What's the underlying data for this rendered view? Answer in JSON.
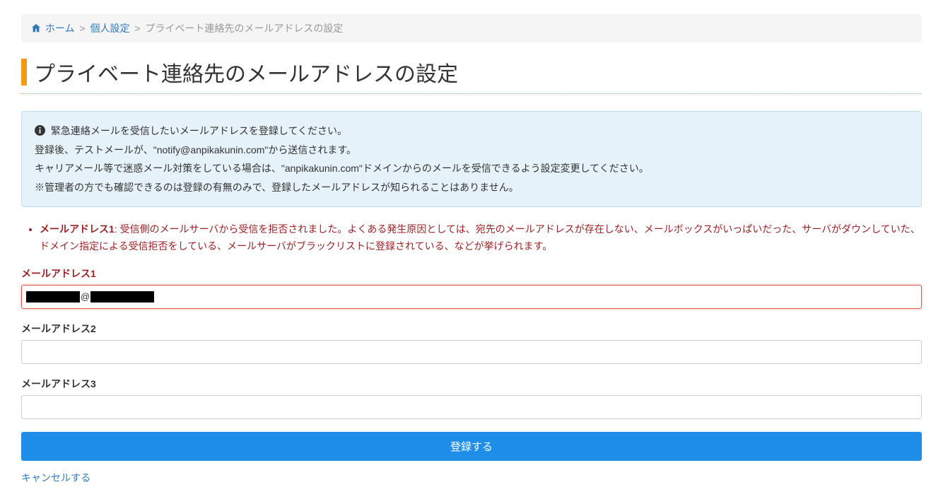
{
  "breadcrumb": {
    "home": "ホーム",
    "personal_settings": "個人設定",
    "current": "プライベート連絡先のメールアドレスの設定"
  },
  "page_title": "プライベート連絡先のメールアドレスの設定",
  "info_box": {
    "line1": "緊急連絡メールを受信したいメールアドレスを登録してください。",
    "line2": "登録後、テストメールが、\"notify@anpikakunin.com\"から送信されます。",
    "line3": "キャリアメール等で迷惑メール対策をしている場合は、\"anpikakunin.com\"ドメインからのメールを受信できるよう設定変更してください。",
    "line4": "※管理者の方でも確認できるのは登録の有無のみで、登録したメールアドレスが知られることはありません。"
  },
  "error": {
    "field_name": "メールアドレス1",
    "message": ": 受信側のメールサーバから受信を拒否されました。よくある発生原因としては、宛先のメールアドレスが存在しない、メールボックスがいっぱいだった、サーバがダウンしていた、ドメイン指定による受信拒否をしている、メールサーバがブラックリストに登録されている、などが挙げられます。"
  },
  "form": {
    "email1_label": "メールアドレス1",
    "email1_value_at": "@",
    "email2_label": "メールアドレス2",
    "email2_value": "",
    "email3_label": "メールアドレス3",
    "email3_value": "",
    "submit_label": "登録する",
    "cancel_label": "キャンセルする"
  }
}
